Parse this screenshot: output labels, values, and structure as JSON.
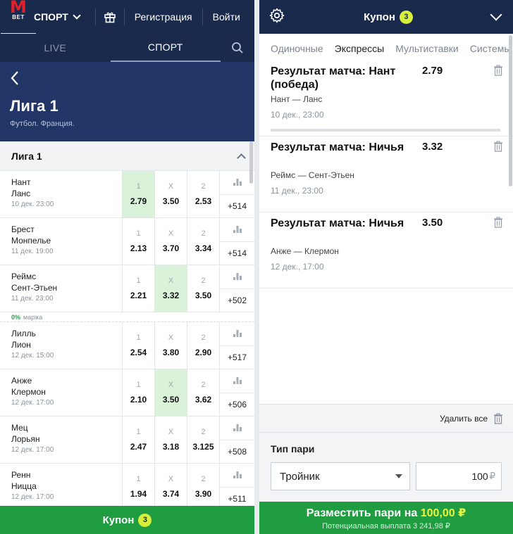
{
  "left": {
    "logo": {
      "m": "M",
      "bet": "BET"
    },
    "sport_label": "СПОРТ",
    "register": "Регистрация",
    "login": "Войти",
    "tabs": [
      "LIVE",
      "СПОРТ"
    ],
    "hero": {
      "title": "Лига 1",
      "subtitle": "Футбол. Франция."
    },
    "league_header": "Лига 1",
    "odd_labels": [
      "1",
      "X",
      "2"
    ],
    "matches": [
      {
        "home": "Нант",
        "away": "Ланс",
        "date": "10 дек. 23:00",
        "odds": [
          "2.79",
          "3.50",
          "2.53"
        ],
        "more": "+514",
        "selected": 0
      },
      {
        "home": "Брест",
        "away": "Монпелье",
        "date": "11 дек. 19:00",
        "odds": [
          "2.13",
          "3.70",
          "3.34"
        ],
        "more": "+514",
        "selected": -1
      },
      {
        "home": "Реймс",
        "away": "Сент-Этьен",
        "date": "11 дек. 23:00",
        "odds": [
          "2.21",
          "3.32",
          "3.50"
        ],
        "more": "+502",
        "selected": 1
      },
      {
        "home": "Лилль",
        "away": "Лион",
        "date": "12 дек. 15:00",
        "odds": [
          "2.54",
          "3.80",
          "2.90"
        ],
        "more": "+517",
        "selected": -1
      },
      {
        "home": "Анже",
        "away": "Клермон",
        "date": "12 дек. 17:00",
        "odds": [
          "2.10",
          "3.50",
          "3.62"
        ],
        "more": "+506",
        "selected": 1
      },
      {
        "home": "Мец",
        "away": "Лорьян",
        "date": "12 дек. 17:00",
        "odds": [
          "2.47",
          "3.18",
          "3.125"
        ],
        "more": "+508",
        "selected": -1
      },
      {
        "home": "Ренн",
        "away": "Ницца",
        "date": "12 дек. 17:00",
        "odds": [
          "1.94",
          "3.74",
          "3.90"
        ],
        "more": "+511",
        "selected": -1
      }
    ],
    "margin": {
      "pct": "0%",
      "text": "маржа"
    },
    "coupon_bar": {
      "label": "Купон",
      "count": "3"
    }
  },
  "right": {
    "title": "Купон",
    "count": "3",
    "tabs": [
      "Одиночные",
      "Экспрессы",
      "Мультиставки",
      "Системы"
    ],
    "active_tab": 1,
    "bets": [
      {
        "name": "Результат матча: Нант (победа)",
        "odd": "2.79",
        "teams": "Нант — Ланс",
        "date": "10 дек., 23:00"
      },
      {
        "name": "Результат матча: Ничья",
        "odd": "3.32",
        "teams": "Реймс — Сент-Этьен",
        "date": "11 дек., 23:00"
      },
      {
        "name": "Результат матча: Ничья",
        "odd": "3.50",
        "teams": "Анже — Клермон",
        "date": "12 дек., 17:00"
      }
    ],
    "delete_all": "Удалить все",
    "bet_type_label": "Тип пари",
    "bet_type_value": "Тройник",
    "stake": "100",
    "currency": "₽",
    "place": {
      "prefix": "Разместить пари на",
      "amount": "100,00 ₽",
      "payout": "Потенциальная выплата 3 241,98 ₽"
    }
  },
  "colors": {
    "navy": "#1a2a4d",
    "hero": "#213566",
    "green": "#1f9d40",
    "selected_odd": "#d9f2d9",
    "badge": "#d6ef3a"
  },
  "icons": [
    "gift-icon",
    "search-icon",
    "back-arrow-icon",
    "stats-icon",
    "gear-icon",
    "trash-icon",
    "chevron-down-icon"
  ]
}
